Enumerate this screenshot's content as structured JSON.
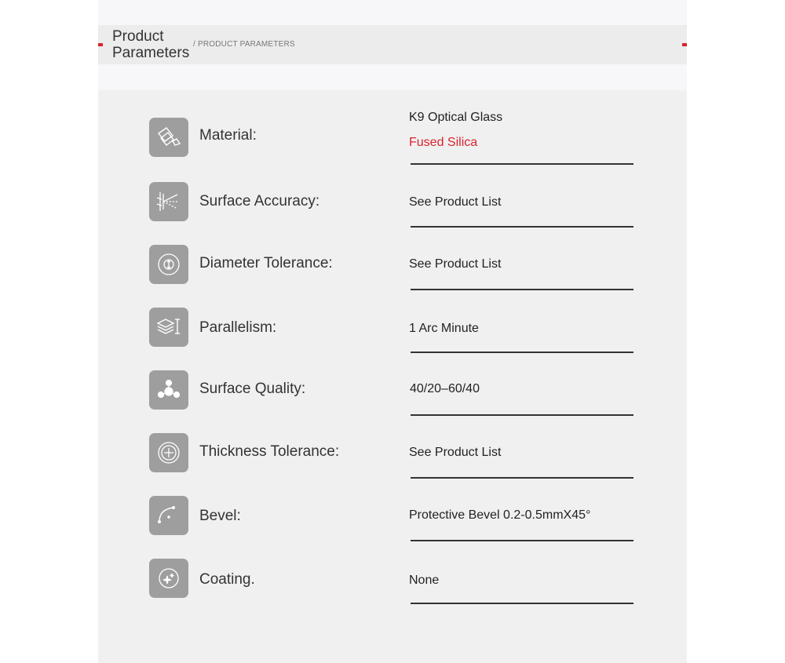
{
  "header": {
    "title": "Product Parameters",
    "subtitle": "/ PRODUCT PARAMETERS"
  },
  "params": [
    {
      "label": "Material:",
      "icon": "glass-icon",
      "value": "K9 Optical Glass",
      "value2": "Fused Silica",
      "value2_color": "#d9232d"
    },
    {
      "label": "Surface Accuracy:",
      "icon": "reflection-icon",
      "value": "See Product List"
    },
    {
      "label": "Diameter Tolerance:",
      "icon": "diameter-icon",
      "value": "See Product List"
    },
    {
      "label": "Parallelism:",
      "icon": "layers-icon",
      "value": "1 Arc Minute"
    },
    {
      "label": "Surface Quality:",
      "icon": "molecule-icon",
      "value": "40/20–60/40"
    },
    {
      "label": "Thickness Tolerance:",
      "icon": "thickness-icon",
      "value": "See Product List"
    },
    {
      "label": "Bevel:",
      "icon": "bevel-curve-icon",
      "value": "Protective Bevel 0.2-0.5mmX45°"
    },
    {
      "label": "Coating.",
      "icon": "sparkle-icon",
      "value": "None"
    }
  ],
  "colors": {
    "accent": "#d9232d",
    "icon_bg": "#9e9e9e",
    "panel_bg": "#f0f0f0"
  }
}
